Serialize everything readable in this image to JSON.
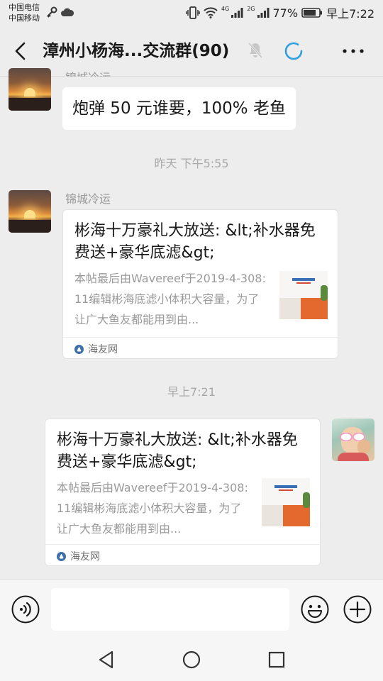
{
  "status_bar": {
    "carrier_1": "中国电信",
    "carrier_2": "中国移动",
    "net_1": "4G",
    "net_2": "2G",
    "battery": "77%",
    "time": "早上7:22"
  },
  "header": {
    "title": "漳州小杨海...交流群(90)",
    "icons": [
      "back-icon",
      "mute-icon",
      "loading-icon",
      "more-icon"
    ]
  },
  "messages": {
    "m1": {
      "sender": "锦城冷运",
      "text": "炮弹 50 元谁要，100% 老鱼"
    },
    "ts1": "昨天 下午5:55",
    "m2": {
      "sender": "锦城冷运",
      "title": "彬海十万豪礼大放送: &lt;补水器免费送+豪华底滤&gt;",
      "desc": "本帖最后由Wavereef于2019-4-308:11编辑彬海底滤小体积大容量，为了让广大鱼友都能用到由...",
      "source": "海友网"
    },
    "ts2": "早上7:21",
    "m3": {
      "title": "彬海十万豪礼大放送: &lt;补水器免费送+豪华底滤&gt;",
      "desc": "本帖最后由Wavereef于2019-4-308:11编辑彬海底滤小体积大容量，为了让广大鱼友都能用到由...",
      "source": "海友网"
    }
  },
  "input_bar": {
    "value": "",
    "icons": [
      "voice-icon",
      "emoji-icon",
      "plus-icon"
    ]
  },
  "system_nav": {
    "icons": [
      "nav-back-icon",
      "nav-home-icon",
      "nav-recent-icon"
    ]
  }
}
